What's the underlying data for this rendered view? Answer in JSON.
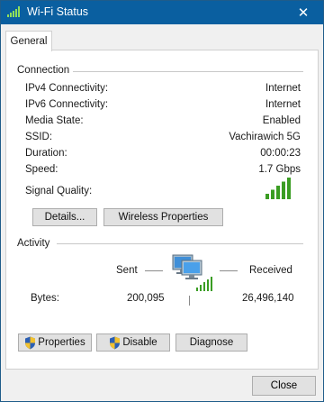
{
  "window": {
    "title": "Wi-Fi Status",
    "close_glyph": "✕"
  },
  "tabs": [
    {
      "label": "General",
      "selected": true
    }
  ],
  "connection": {
    "heading": "Connection",
    "rows": [
      {
        "label": "IPv4 Connectivity:",
        "value": "Internet"
      },
      {
        "label": "IPv6 Connectivity:",
        "value": "Internet"
      },
      {
        "label": "Media State:",
        "value": "Enabled"
      },
      {
        "label": "SSID:",
        "value": "Vachirawich 5G"
      },
      {
        "label": "Duration:",
        "value": "00:00:23"
      },
      {
        "label": "Speed:",
        "value": "1.7 Gbps"
      }
    ],
    "signal_label": "Signal Quality:",
    "signal_bars": 5,
    "signal_bars_max": 5,
    "buttons": {
      "details": "Details...",
      "wireless_properties": "Wireless Properties"
    }
  },
  "activity": {
    "heading": "Activity",
    "sent_label": "Sent",
    "received_label": "Received",
    "bytes_label": "Bytes:",
    "sent_bytes": "200,095",
    "received_bytes": "26,496,140"
  },
  "action_buttons": {
    "properties": "Properties",
    "disable": "Disable",
    "diagnose": "Diagnose"
  },
  "footer": {
    "close": "Close"
  },
  "colors": {
    "titlebar": "#0a5fa0",
    "signal": "#3a9d23",
    "shield_blue": "#2b5fb4",
    "shield_yellow": "#f2c12e"
  },
  "icons": {
    "title": "wifi-signal-icon",
    "network": "network-computers-icon",
    "shield": "uac-shield-icon"
  }
}
